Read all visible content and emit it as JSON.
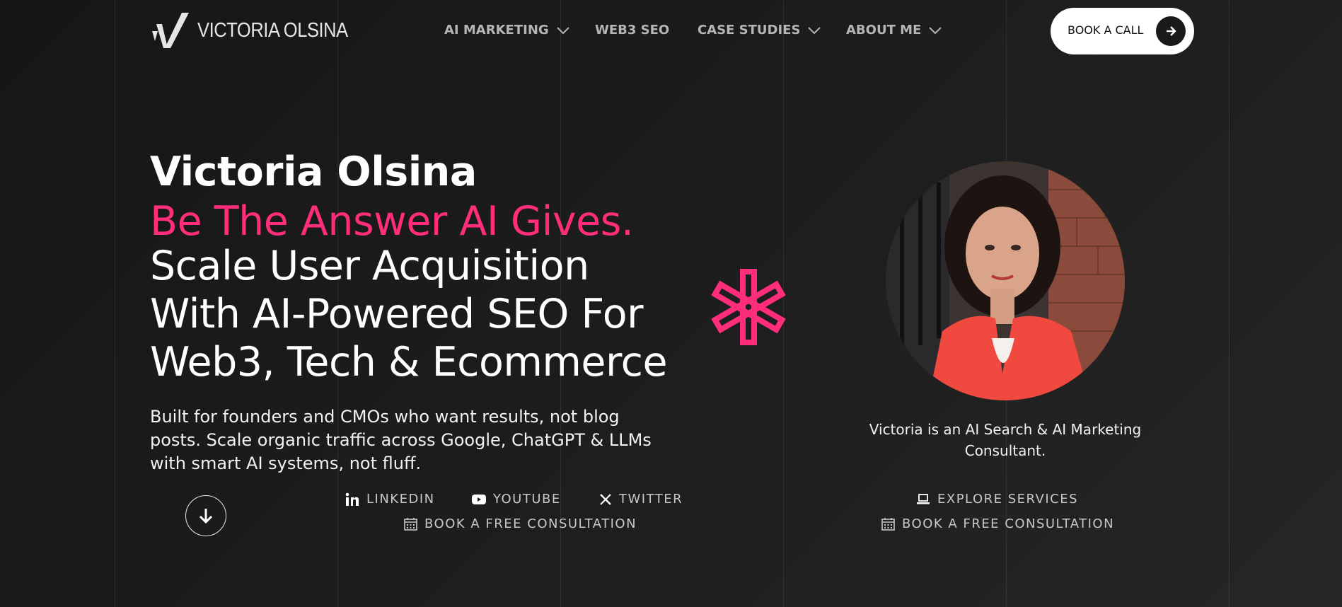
{
  "brand": {
    "name": "VICTORIA OLSINA",
    "logo_icon": "v-monogram"
  },
  "nav": [
    {
      "label": "AI MARKETING",
      "has_dropdown": true
    },
    {
      "label": "WEB3 SEO",
      "has_dropdown": false
    },
    {
      "label": "CASE STUDIES",
      "has_dropdown": true
    },
    {
      "label": "ABOUT ME",
      "has_dropdown": true
    }
  ],
  "cta": {
    "label": "BOOK A CALL",
    "icon": "arrow-right-icon"
  },
  "hero": {
    "name": "Victoria Olsina",
    "tagline": "Be The Answer AI Gives.",
    "headline": [
      "Scale User Acquisition",
      "With AI-Powered SEO For",
      "Web3, Tech & Ecommerce"
    ],
    "description": "Built for founders and CMOs who want results, not blog posts. Scale organic traffic across Google, ChatGPT & LLMs with smart AI systems, not fluff."
  },
  "social_links": [
    {
      "label": "LINKEDIN",
      "icon": "linkedin-icon"
    },
    {
      "label": "YOUTUBE",
      "icon": "youtube-icon"
    },
    {
      "label": "TWITTER",
      "icon": "x-icon"
    }
  ],
  "left_consultation": {
    "label": "BOOK A FREE CONSULTATION",
    "icon": "calendar-icon"
  },
  "profile": {
    "caption": "Victoria is an AI Search & AI Marketing Consultant.",
    "explore_label": "EXPLORE SERVICES",
    "consultation_label": "BOOK A FREE CONSULTATION"
  },
  "colors": {
    "accent": "#ff2d7a",
    "background": "#1c1c1c",
    "text": "#ffffff",
    "muted": "#b5b5b5"
  }
}
